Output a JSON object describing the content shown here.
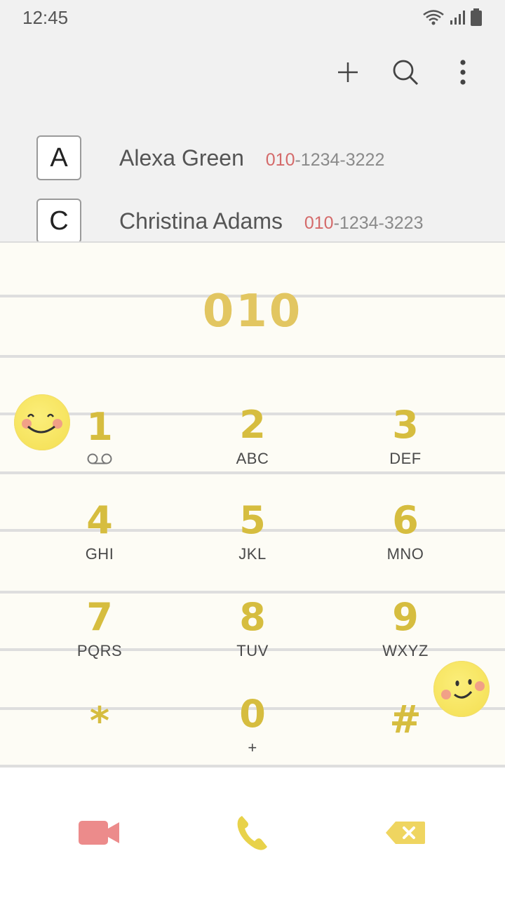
{
  "status_bar": {
    "time": "12:45"
  },
  "contacts": [
    {
      "index": "A",
      "name": "Alexa Green",
      "number_match": "010",
      "number_rest": "-1234-3222"
    },
    {
      "index": "C",
      "name": "Christina Adams",
      "number_match": "010",
      "number_rest": "-1234-3223"
    }
  ],
  "dialer": {
    "entered_digits": "010",
    "keys": [
      {
        "digit": "1",
        "letters": ""
      },
      {
        "digit": "2",
        "letters": "ABC"
      },
      {
        "digit": "3",
        "letters": "DEF"
      },
      {
        "digit": "4",
        "letters": "GHI"
      },
      {
        "digit": "5",
        "letters": "JKL"
      },
      {
        "digit": "6",
        "letters": "MNO"
      },
      {
        "digit": "7",
        "letters": "PQRS"
      },
      {
        "digit": "8",
        "letters": "TUV"
      },
      {
        "digit": "9",
        "letters": "WXYZ"
      },
      {
        "digit": "*",
        "letters": ""
      },
      {
        "digit": "0",
        "letters": "+"
      },
      {
        "digit": "#",
        "letters": ""
      }
    ]
  },
  "colors": {
    "accent_yellow": "#d6bd3f",
    "highlight_red": "#d46a6a",
    "video_call_red": "#ec8b8b"
  },
  "icons": {
    "add": "plus-icon",
    "search": "search-icon",
    "more": "more-vertical-icon",
    "voicemail": "voicemail-icon",
    "video_call": "video-camera-icon",
    "call": "phone-icon",
    "backspace": "backspace-icon"
  }
}
